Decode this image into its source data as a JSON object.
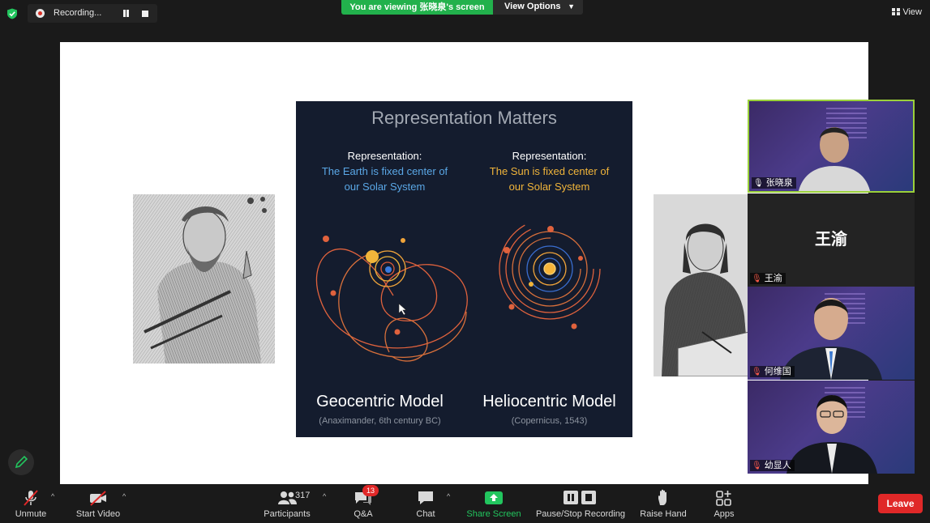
{
  "topbar": {
    "recording_label": "Recording...",
    "viewing_banner": "You are viewing 张晓泉's screen",
    "view_options_label": "View Options",
    "view_label": "View"
  },
  "slide": {
    "title": "Representation Matters",
    "left": {
      "head_line1": "Representation:",
      "head_line2": "The Earth is fixed center of",
      "head_line3": "our Solar System",
      "model_name": "Geocentric Model",
      "model_sub": "(Anaximander,  6th century BC)"
    },
    "right": {
      "head_line1": "Representation:",
      "head_line2": "The Sun is fixed center of",
      "head_line3": "our Solar System",
      "model_name": "Heliocentric Model",
      "model_sub": "(Copernicus,  1543)"
    }
  },
  "participants_gallery": [
    {
      "name": "张晓泉",
      "muted": false,
      "video": true
    },
    {
      "name": "王渝",
      "display_name": "王渝",
      "muted": true,
      "video": false
    },
    {
      "name": "何维国",
      "muted": true,
      "video": true
    },
    {
      "name": "幼显人",
      "muted": true,
      "video": true
    }
  ],
  "toolbar": {
    "unmute": "Unmute",
    "start_video": "Start Video",
    "participants": "Participants",
    "participants_count": "317",
    "qa": "Q&A",
    "qa_badge": "13",
    "chat": "Chat",
    "share_screen": "Share Screen",
    "pause_stop_recording": "Pause/Stop Recording",
    "raise_hand": "Raise Hand",
    "apps": "Apps",
    "leave": "Leave"
  },
  "colors": {
    "share_green": "#22b14c",
    "leave_red": "#e02828",
    "active_speaker": "#9bd13a",
    "slide_bg": "#141c2e",
    "blue_text": "#5aa7e6",
    "gold_text": "#f0b43a"
  }
}
